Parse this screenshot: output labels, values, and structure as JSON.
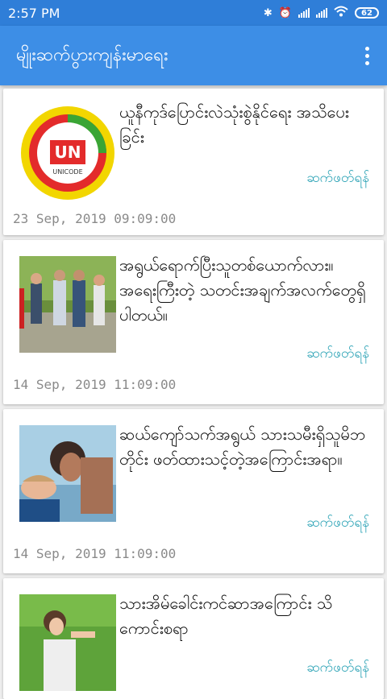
{
  "status": {
    "time": "2:57 PM",
    "battery": "62"
  },
  "app": {
    "title": "မျိုးဆက်ပွားကျန်းမာရေး"
  },
  "readmore_label": "ဆက်ဖတ်ရန်",
  "articles": [
    {
      "headline": "ယူနီကုဒ်ပြောင်းလဲသုံးစွဲနိုင်ရေး အသိပေးခြင်း",
      "date": "23 Sep, 2019 09:09:00",
      "logo_text": "UNICODE"
    },
    {
      "headline": "အရွယ်ရောက်ပြီးသူတစ်ယောက်လား။ အရေးကြီးတဲ့ သတင်းအချက်အလက်တွေရှိပါတယ်။",
      "date": "14 Sep, 2019 11:09:00"
    },
    {
      "headline": "ဆယ်ကျော်သက်အရွယ် သားသမီးရှိသူမိဘတိုင်း ဖတ်ထားသင့်တဲ့အကြောင်းအရာ။",
      "date": "14 Sep, 2019 11:09:00"
    },
    {
      "headline": "သားအိမ်ခေါင်းကင်ဆာအကြောင်း သိကောင်းစရာ",
      "date": ""
    }
  ],
  "colors": {
    "statusbar": "#2f7ed8",
    "appbar": "#3d8ee6",
    "link": "#2aa2b5"
  }
}
